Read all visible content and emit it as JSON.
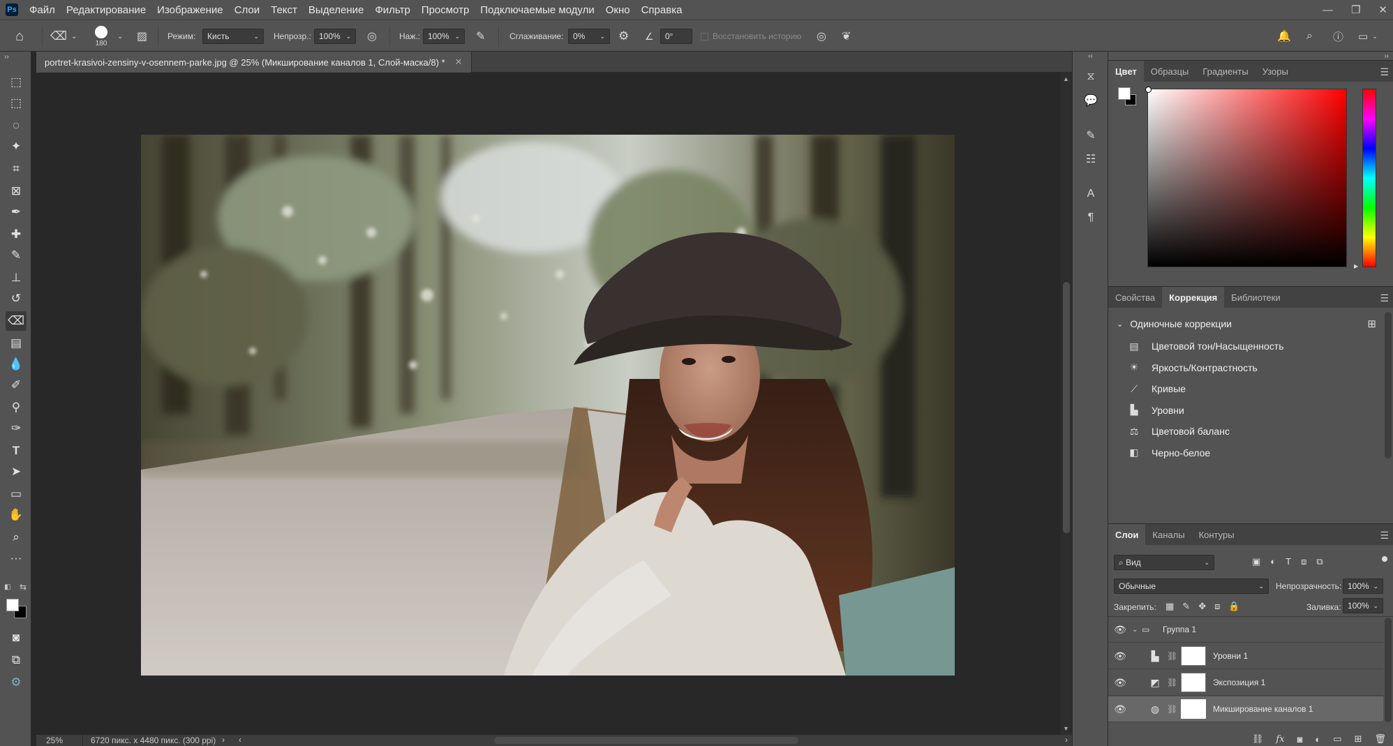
{
  "app": {
    "name": "Ps"
  },
  "menu": {
    "items": [
      "Файл",
      "Редактирование",
      "Изображение",
      "Слои",
      "Текст",
      "Выделение",
      "Фильтр",
      "Просмотр",
      "Подключаемые модули",
      "Окно",
      "Справка"
    ]
  },
  "window_controls": {
    "minimize_icon": "minimize-icon",
    "restore_icon": "restore-icon",
    "close_icon": "close-icon"
  },
  "options": {
    "brush_size": "180",
    "mode_label": "Режим:",
    "mode_value": "Кисть",
    "opacity_label": "Непрозр.:",
    "opacity_value": "100%",
    "flow_label": "Наж.:",
    "flow_value": "100%",
    "smoothing_label": "Сглаживание:",
    "smoothing_value": "0%",
    "angle_value": "0°",
    "restore_history_label": "Восстановить историю"
  },
  "document": {
    "tab_title": "portret-krasivoi-zensiny-v-osennem-parke.jpg @ 25% (Микширование каналов 1, Слой-маска/8) *"
  },
  "status": {
    "zoom": "25%",
    "dimensions": "6720 пикс. x 4480 пикс. (300 ppi)"
  },
  "color_panel": {
    "tabs": [
      "Цвет",
      "Образцы",
      "Градиенты",
      "Узоры"
    ],
    "active": 0
  },
  "adjust_panel": {
    "tabs": [
      "Свойства",
      "Коррекция",
      "Библиотеки"
    ],
    "active": 1,
    "section_title": "Одиночные коррекции",
    "items": [
      {
        "label": "Цветовой тон/Насыщенность",
        "icon": "hue-saturation-icon"
      },
      {
        "label": "Яркость/Контрастность",
        "icon": "brightness-contrast-icon"
      },
      {
        "label": "Кривые",
        "icon": "curves-icon"
      },
      {
        "label": "Уровни",
        "icon": "levels-icon"
      },
      {
        "label": "Цветовой баланс",
        "icon": "color-balance-icon"
      },
      {
        "label": "Черно-белое",
        "icon": "black-white-icon"
      }
    ]
  },
  "layers_panel": {
    "tabs": [
      "Слои",
      "Каналы",
      "Контуры"
    ],
    "active": 0,
    "filter_value": "Вид",
    "blend_mode": "Обычные",
    "opacity_label": "Непрозрачность:",
    "opacity_value": "100%",
    "lock_label": "Закрепить:",
    "fill_label": "Заливка:",
    "fill_value": "100%",
    "layers": [
      {
        "name": "Группа 1",
        "type": "group",
        "icon": "folder-icon"
      },
      {
        "name": "Уровни 1",
        "type": "adjustment",
        "icon": "levels-icon"
      },
      {
        "name": "Экспозиция 1",
        "type": "adjustment",
        "icon": "exposure-icon"
      },
      {
        "name": "Микширование каналов 1",
        "type": "adjustment",
        "icon": "channel-mixer-icon",
        "selected": true
      }
    ],
    "footer_fx": "fx"
  },
  "colors": {
    "ui_bg": "#535353",
    "canvas_bg": "#282828",
    "accent": "#31a8ff"
  }
}
